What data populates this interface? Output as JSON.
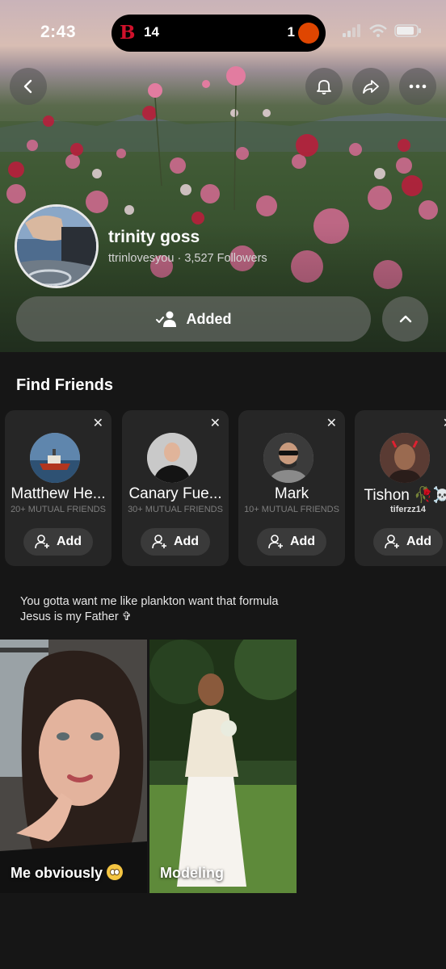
{
  "status_bar": {
    "time": "2:43",
    "score_left": "14",
    "score_right": "1",
    "team_left_logo": "B"
  },
  "profile": {
    "name": "trinity goss",
    "username": "ttrinlovesyou",
    "separator": "·",
    "followers": "3,527 Followers",
    "added_label": "Added"
  },
  "find_friends": {
    "title": "Find Friends",
    "add_label": "Add",
    "cards": [
      {
        "name": "Matthew He...",
        "sub": "20+ MUTUAL FRIENDS"
      },
      {
        "name": "Canary Fue...",
        "sub": "30+ MUTUAL FRIENDS"
      },
      {
        "name": "Mark",
        "sub": "10+ MUTUAL FRIENDS"
      },
      {
        "name": "Tishon 🥀☠️",
        "sub": "tiferzz14"
      }
    ]
  },
  "bio": {
    "line1": "You gotta want me like plankton want that formula",
    "line2": "Jesus is my Father ✞"
  },
  "stories": [
    {
      "label": "Me obviously"
    },
    {
      "label": "Modeling"
    }
  ],
  "colors": {
    "background": "#161616",
    "card": "#262626",
    "accent_red": "#d0112b",
    "orioles_orange": "#df4601"
  },
  "icons": [
    "back-icon",
    "bell-icon",
    "share-icon",
    "more-icon",
    "person-check-icon",
    "chevron-up-icon",
    "close-icon",
    "add-friend-icon",
    "signal-icon",
    "wifi-icon",
    "battery-icon"
  ]
}
